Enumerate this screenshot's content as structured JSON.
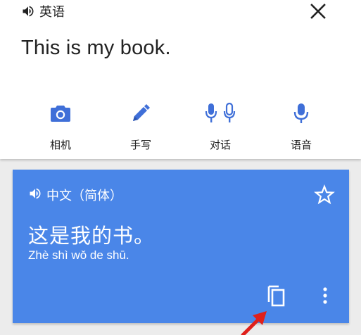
{
  "source": {
    "language": "英语",
    "text": "This is my book."
  },
  "tools": [
    {
      "label": "相机",
      "icon": "camera-icon"
    },
    {
      "label": "手写",
      "icon": "pen-icon"
    },
    {
      "label": "对话",
      "icon": "conversation-mic-icon"
    },
    {
      "label": "语音",
      "icon": "mic-icon"
    }
  ],
  "result": {
    "language": "中文（简体）",
    "translation": "这是我的书。",
    "romanization": "Zhè shì wǒ de shū."
  },
  "colors": {
    "accent_blue": "#4a86e8",
    "icon_blue": "#3f6fd8",
    "arrow_red": "#e0201b"
  }
}
